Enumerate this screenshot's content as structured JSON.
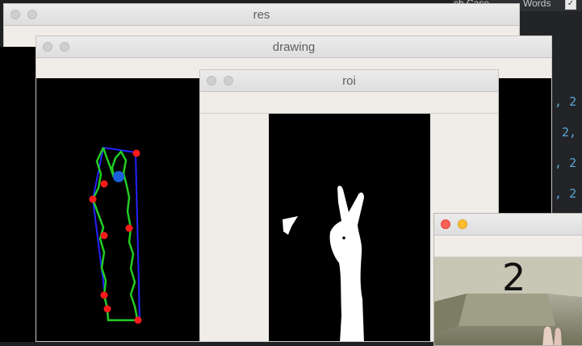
{
  "editor": {
    "find_bar": {
      "match_case_label": "ch Case",
      "words_label": "Words",
      "words_checked": "✓"
    },
    "code_lines": [
      "', 2",
      "2,",
      "', 2",
      "', 2"
    ],
    "code_color": "#5aa6d8"
  },
  "windows": {
    "res": {
      "title": "res"
    },
    "drawing": {
      "title": "drawing"
    },
    "roi": {
      "title": "roi"
    },
    "camera": {
      "overlay_text": "2"
    }
  },
  "colors": {
    "hull": "#2222ff",
    "contour": "#22cc22",
    "defect_points": "#ff1a1a",
    "center_point": "#1a5fd8",
    "close_light": "#fe5f57",
    "minimize_light": "#febc2e"
  }
}
